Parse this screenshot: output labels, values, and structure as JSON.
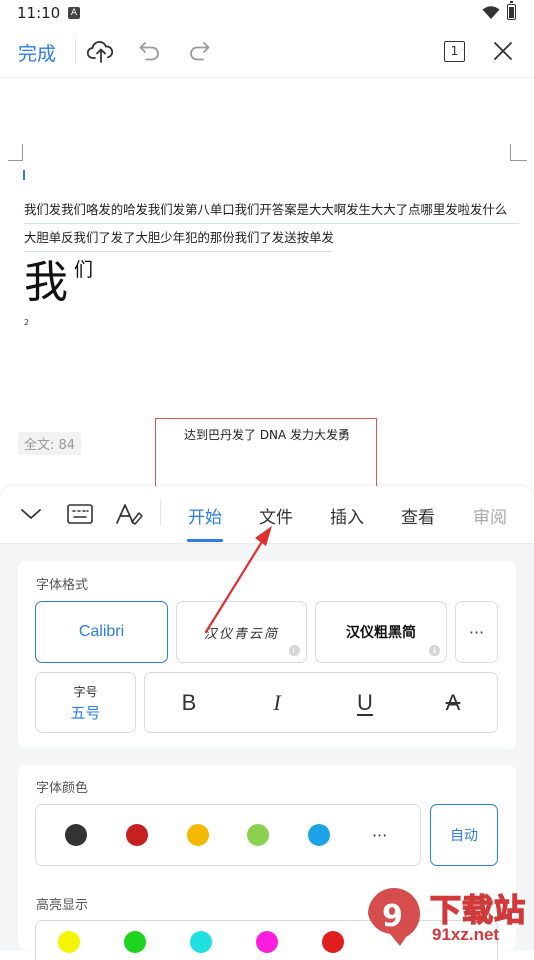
{
  "status_bar": {
    "time": "11:10",
    "notification_badge": "A"
  },
  "toolbar": {
    "done_label": "完成",
    "page_count": "1",
    "icons": [
      "cloud-upload-icon",
      "undo-icon",
      "redo-icon",
      "page-count-icon",
      "close-icon"
    ]
  },
  "document": {
    "paragraphs": [
      "我们发我们咯发的哈发我们发第八单口我们开答案是大大啊发生大大了点哪里发啦发什么",
      "大胆单反我们了发了大胆少年犯的那份我们了发送按单发"
    ],
    "big_char": "我",
    "sup_char": "们",
    "small_number": "2",
    "word_count": "全文: 84",
    "textbox_text": "达到巴丹发了 DNA 发力大发勇"
  },
  "tabs": [
    {
      "label": "开始",
      "active": true
    },
    {
      "label": "文件",
      "active": false
    },
    {
      "label": "插入",
      "active": false
    },
    {
      "label": "查看",
      "active": false
    },
    {
      "label": "审阅",
      "active": false
    }
  ],
  "font_format": {
    "title": "字体格式",
    "fonts": [
      "Calibri",
      "汉仪青云简",
      "汉仪粗黑简"
    ],
    "more_label": "···",
    "size_label": "字号",
    "size_value": "五号",
    "styles": {
      "bold": "B",
      "italic": "I",
      "underline": "U",
      "strike": "A"
    }
  },
  "font_color": {
    "title": "字体颜色",
    "swatches": [
      "#333333",
      "#c62020",
      "#f5b800",
      "#8bd150",
      "#1aa3e6"
    ],
    "more_label": "···",
    "auto_label": "自动"
  },
  "highlight": {
    "title": "高亮显示",
    "swatches": [
      "#f5f500",
      "#1ed41e",
      "#1ee0e0",
      "#ff1ee0",
      "#e01e1e"
    ]
  },
  "watermark": {
    "line1": "下载站",
    "line2": "91xz.net",
    "glyph": "9"
  },
  "colors": {
    "accent": "#2b7de9",
    "annotation": "#e03030"
  }
}
